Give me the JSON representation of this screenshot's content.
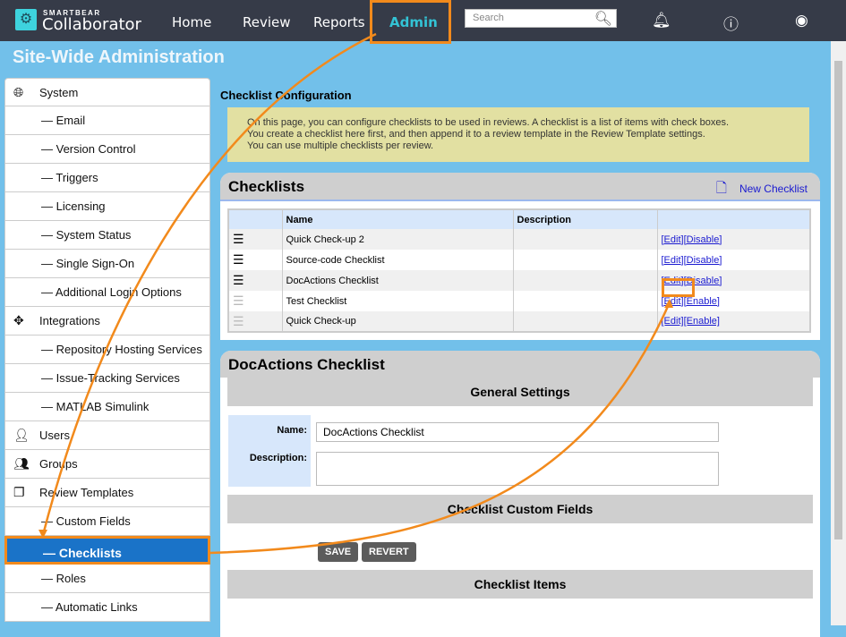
{
  "header": {
    "brand_small": "SMARTBEAR",
    "brand": "Collaborator",
    "nav": [
      "Home",
      "Review",
      "Reports",
      "Admin"
    ],
    "search_placeholder": "Search"
  },
  "page_title": "Site-Wide Administration",
  "sidebar": [
    {
      "label": "System",
      "icon": "globe-icon",
      "sub": false
    },
    {
      "label": "— Email",
      "sub": true
    },
    {
      "label": "— Version Control",
      "sub": true
    },
    {
      "label": "— Triggers",
      "sub": true
    },
    {
      "label": "— Licensing",
      "sub": true
    },
    {
      "label": "— System Status",
      "sub": true
    },
    {
      "label": "— Single Sign-On",
      "sub": true
    },
    {
      "label": "— Additional Login Options",
      "sub": true
    },
    {
      "label": "Integrations",
      "icon": "move-icon",
      "sub": false
    },
    {
      "label": "— Repository Hosting Services",
      "sub": true
    },
    {
      "label": "— Issue-Tracking Services",
      "sub": true
    },
    {
      "label": "— MATLAB Simulink",
      "sub": true
    },
    {
      "label": "Users",
      "icon": "user-icon",
      "sub": false
    },
    {
      "label": "Groups",
      "icon": "users-icon",
      "sub": false
    },
    {
      "label": "Review Templates",
      "icon": "copy-icon",
      "sub": false
    },
    {
      "label": "— Custom Fields",
      "sub": true
    },
    {
      "label": "— Checklists",
      "sub": true,
      "selected": true
    },
    {
      "label": "— Roles",
      "sub": true
    },
    {
      "label": "— Automatic Links",
      "sub": true
    }
  ],
  "main": {
    "heading": "Checklist Configuration",
    "note": [
      "On this page, you can configure checklists to be used in reviews. A checklist is a list of items with check boxes.",
      "You create a checklist here first, and then append it to a review template in the Review Template settings.",
      "You can use multiple checklists per review."
    ],
    "checklists": {
      "title": "Checklists",
      "new_label": "New Checklist",
      "columns": [
        "Name",
        "Description",
        ""
      ],
      "rows": [
        {
          "name": "Quick Check-up 2",
          "description": "",
          "edit": "[Edit]",
          "toggle": "[Disable]",
          "enabled": true
        },
        {
          "name": "Source-code Checklist",
          "description": "",
          "edit": "[Edit]",
          "toggle": "[Disable]",
          "enabled": true
        },
        {
          "name": "DocActions Checklist",
          "description": "",
          "edit": "[Edit]",
          "toggle": "[Disable]",
          "enabled": true
        },
        {
          "name": "Test Checklist",
          "description": "",
          "edit": "[Edit]",
          "toggle": "[Enable]",
          "enabled": false
        },
        {
          "name": "Quick Check-up",
          "description": "",
          "edit": "[Edit]",
          "toggle": "[Enable]",
          "enabled": false
        }
      ]
    },
    "detail": {
      "title": "DocActions Checklist",
      "general": "General Settings",
      "name_label": "Name:",
      "name_value": "DocActions Checklist",
      "desc_label": "Description:",
      "desc_value": "",
      "custom_fields": "Checklist Custom Fields",
      "save": "SAVE",
      "revert": "REVERT",
      "items": "Checklist Items"
    }
  }
}
